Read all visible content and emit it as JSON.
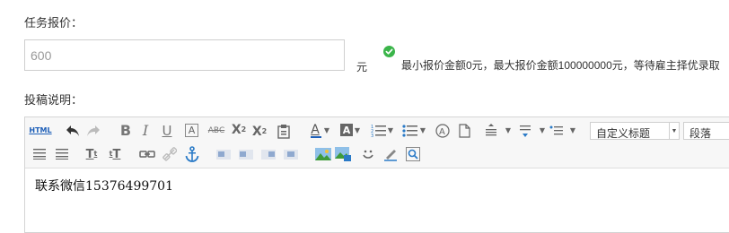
{
  "price": {
    "label": "任务报价：",
    "value": "600",
    "unit": "元",
    "hint": "最小报价金额0元，最大报价金额100000000元，等待雇主择优录取"
  },
  "description": {
    "label": "投稿说明：",
    "content": "联系微信15376499701"
  },
  "toolbar": {
    "html_label": "HTML",
    "strikethrough_label": "ABC",
    "heading_select": "自定义标题",
    "paragraph_select": "段落"
  },
  "colors": {
    "ok_green": "#3bb54a",
    "anchor_blue": "#2a7ac7",
    "html_blue": "#1e5fb8"
  }
}
